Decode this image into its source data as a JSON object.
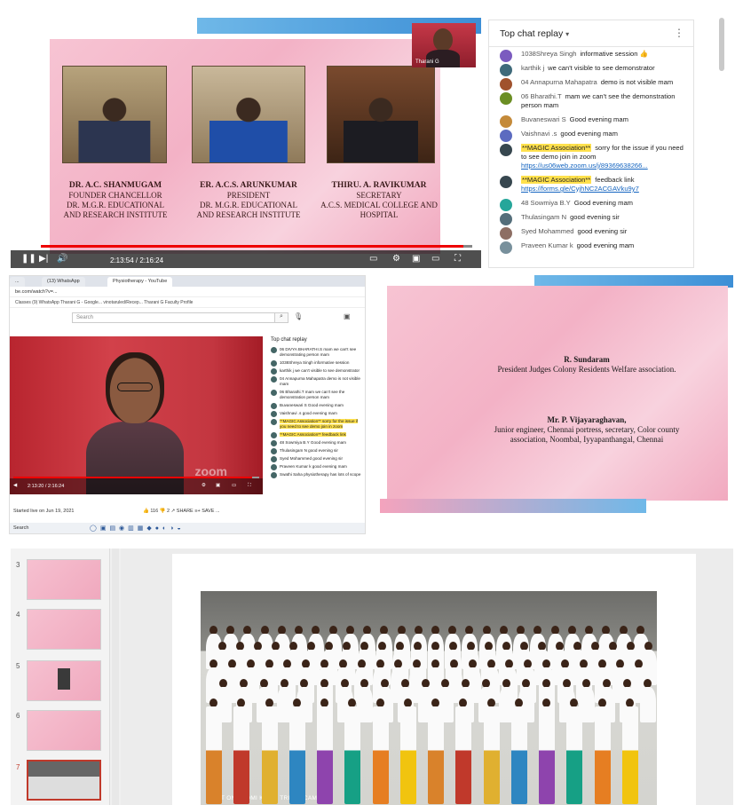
{
  "panel1": {
    "founders": [
      {
        "name": "DR. A.C. SHANMUGAM",
        "lines": [
          "FOUNDER CHANCELLOR",
          "DR. M.G.R. EDUCATIONAL",
          "AND RESEARCH INSTITUTE"
        ]
      },
      {
        "name": "ER. A.C.S. ARUNKUMAR",
        "lines": [
          "PRESIDENT",
          "DR. M.G.R. EDUCATIONAL",
          "AND RESEARCH INSTITUTE"
        ]
      },
      {
        "name": "THIRU. A. RAVIKUMAR",
        "lines": [
          "SECRETARY",
          "A.C.S. MEDICAL COLLEGE AND",
          "HOSPITAL"
        ]
      }
    ],
    "cam_label": "Tharani G",
    "time": "2:13:54 / 2:16:24",
    "progress": 0.98,
    "chat": {
      "header": "Top chat replay",
      "messages": [
        {
          "author": "1038Shreya Singh",
          "text": "informative session 👍",
          "color": "#7b5bbf"
        },
        {
          "author": "karthik j",
          "text": "we can't visible to see demonstrator",
          "color": "#3f6a7a"
        },
        {
          "author": "04 Annapurna Mahapatra",
          "text": "demo is not visible mam",
          "color": "#a0522d"
        },
        {
          "author": "06 Bharathi.T",
          "text": "mam we can't see the demonstration person mam",
          "color": "#6b8e23"
        },
        {
          "author": "Buvaneswari S",
          "text": "Good evening mam",
          "color": "#c48a3a"
        },
        {
          "author": "Vaishnavi .s",
          "text": "good evening mam",
          "color": "#5c6bc0"
        },
        {
          "author": "**MAGIC Association**",
          "text": "sorry for the issue if you need to see demo join in zoom ",
          "link": "https://us06web.zoom.us/j/89369638266...",
          "color": "#37474f",
          "highlight": true
        },
        {
          "author": "**MAGIC Association**",
          "text": "feedback link ",
          "link": "https://forms.gle/CyjhNC2ACGAVku9y7",
          "color": "#37474f",
          "highlight": true
        },
        {
          "author": "48 Sowmiya B.Y",
          "text": "Good evening mam",
          "color": "#26a69a"
        },
        {
          "author": "Thulasingam N",
          "text": "good evening sir",
          "color": "#546e7a"
        },
        {
          "author": "Syed Mohammed",
          "text": "good evening sir",
          "color": "#8d6e63"
        },
        {
          "author": "Praveen Kumar k",
          "text": "good evening mam",
          "color": "#78909c"
        }
      ]
    }
  },
  "panel2": {
    "tabs": [
      "...",
      "(13) WhatsApp",
      "Physiotherapy - YouTube"
    ],
    "url": "be.com/watch?v=...",
    "bookmarks": "Classes   (9) WhatsApp   Tharani G - Google...   vinotaruled/Recep...   Tharani G   Faculty Profile",
    "search_placeholder": "Search",
    "video_time": "2:13:20 / 2:16:24",
    "progress": 0.97,
    "zoom_text": "zoom",
    "meta": "Started live on Jun 19, 2021",
    "meta_actions": "👍 116   👎 2   ↗ SHARE   ≡+ SAVE   ...",
    "taskbar_search": "Search",
    "chat": {
      "header": "Top chat replay",
      "messages": [
        "06 DIVYA BHARATHI.S  mam we can't see demonstrating person mam",
        "1038Shreya Singh  informative session",
        "karthik j  we can't visible to see demonstrator",
        "04 Annapurna Mahapatra  demo is not visible mam",
        "06 Bharathi.T  mam we can't see the demonstration person mam",
        "Buvaneswari S  Good evening mam",
        "Vaishnavi .s  good evening mam",
        "**MAGIC Association**  sorry for the issue if you need to see demo join in zoom",
        "**MAGIC Association**  feedback link",
        "48 Sowmiya B.Y  Good evening mam",
        "Thulasingam N  good evening sir",
        "Syed Mohammed  good evening sir",
        "Praveen Kumar k  good evening mam",
        "Swathi Saha  physiotherapy has lots of scope"
      ]
    }
  },
  "panel3": {
    "name1": "R. Sundaram",
    "line1": "President Judges Colony Residents Welfare association.",
    "name2": "Mr. P. Vijayaraghavan,",
    "line2": "Junior engineer, Chennai portress, secretary, Color county association, Noombal, Iyyapanthangal,  Chennai"
  },
  "panel4": {
    "slide_numbers": [
      "3",
      "4",
      "5",
      "6",
      "7"
    ],
    "selected": "7",
    "photo_caption": "SHOT ON REDMI K20 AI TRIPLE CAMERA"
  }
}
